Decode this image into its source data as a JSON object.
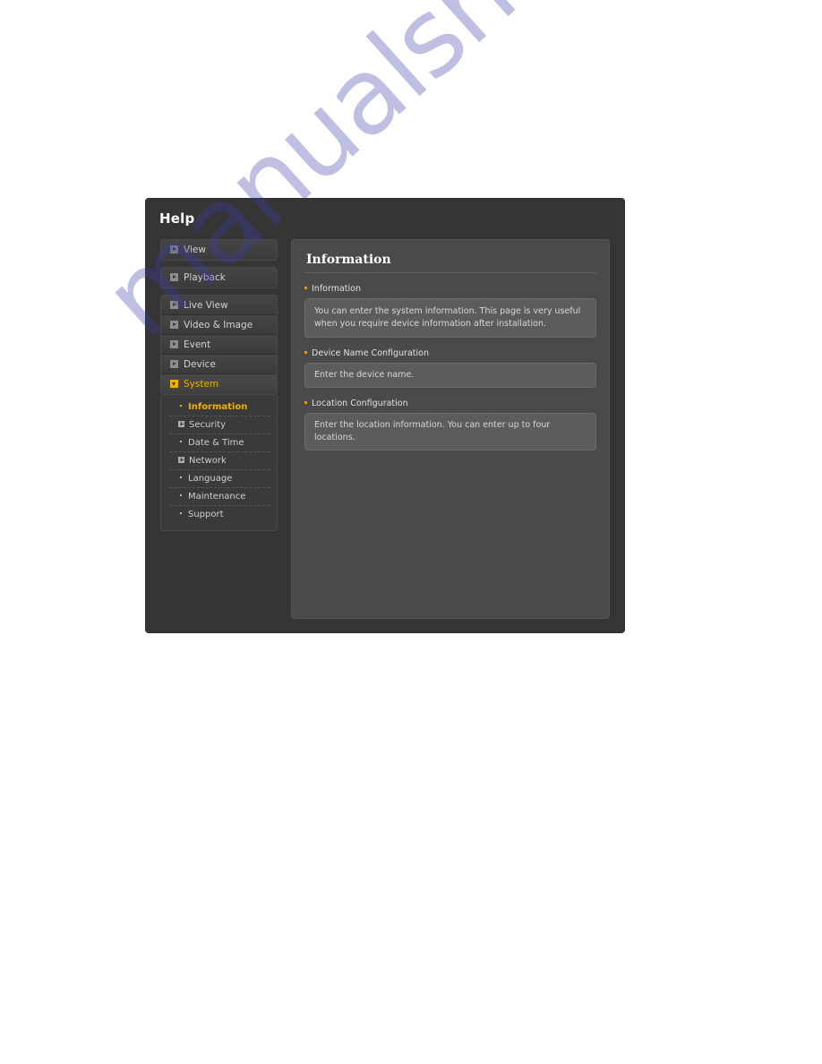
{
  "app": {
    "title": "Help"
  },
  "sidebar": {
    "blocks": [
      {
        "grouped": false,
        "items": [
          {
            "label": "View",
            "icon": "triangle-right-icon",
            "state": "collapsed"
          }
        ]
      },
      {
        "grouped": false,
        "items": [
          {
            "label": "Playback",
            "icon": "triangle-right-icon",
            "state": "collapsed"
          }
        ]
      },
      {
        "grouped": true,
        "items": [
          {
            "label": "Live View",
            "icon": "triangle-right-icon",
            "state": "collapsed"
          },
          {
            "label": "Video & Image",
            "icon": "triangle-right-icon",
            "state": "collapsed"
          },
          {
            "label": "Event",
            "icon": "triangle-right-icon",
            "state": "collapsed"
          },
          {
            "label": "Device",
            "icon": "triangle-right-icon",
            "state": "collapsed"
          },
          {
            "label": "System",
            "icon": "triangle-down-icon",
            "state": "expanded"
          }
        ]
      }
    ],
    "submenu": [
      {
        "label": "Information",
        "marker": "dot",
        "active": true
      },
      {
        "label": "Security",
        "marker": "plus",
        "active": false
      },
      {
        "label": "Date & Time",
        "marker": "dot",
        "active": false
      },
      {
        "label": "Network",
        "marker": "plus",
        "active": false
      },
      {
        "label": "Language",
        "marker": "dot",
        "active": false
      },
      {
        "label": "Maintenance",
        "marker": "dot",
        "active": false
      },
      {
        "label": "Support",
        "marker": "dot",
        "active": false
      }
    ]
  },
  "content": {
    "heading": "Information",
    "sections": [
      {
        "label": "Information",
        "text": "You can enter the system information. This page is very useful when you require device information after installation."
      },
      {
        "label": "Device Name Configuration",
        "text": "Enter the device name."
      },
      {
        "label": "Location Configuration",
        "text": "Enter the location information. You can enter up to four locations."
      }
    ]
  },
  "watermark": {
    "text": "manualshive.com"
  },
  "colors": {
    "accent": "#f0b000",
    "bullet": "#e09b10",
    "window_bg": "#353535",
    "panel_bg": "#4a4a4a",
    "box_bg": "#5c5c5c"
  }
}
